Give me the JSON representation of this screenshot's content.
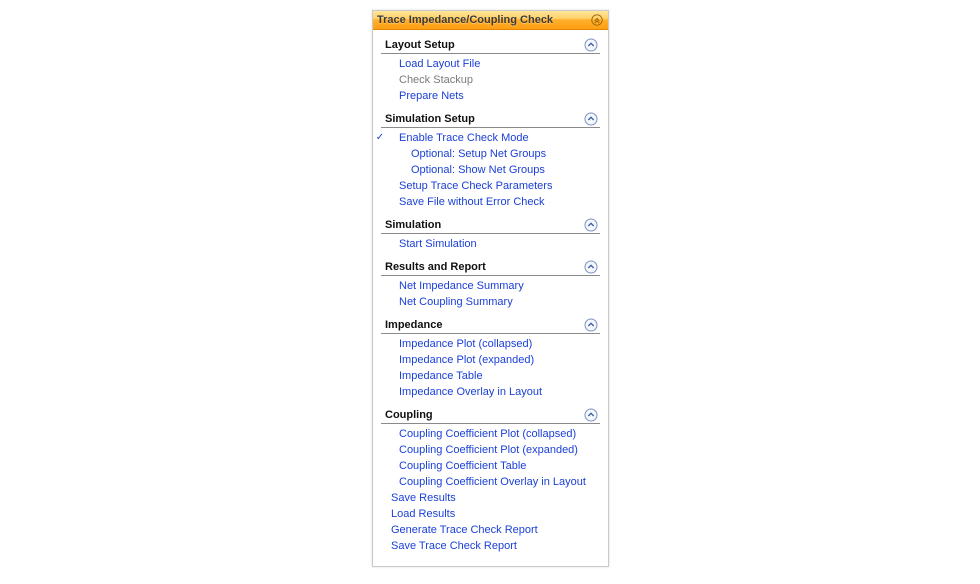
{
  "panel": {
    "title": "Trace Impedance/Coupling Check"
  },
  "sections": {
    "layout_setup": {
      "title": "Layout Setup",
      "items": {
        "load_layout_file": "Load Layout File",
        "check_stackup": "Check Stackup",
        "prepare_nets": "Prepare Nets"
      }
    },
    "simulation_setup": {
      "title": "Simulation Setup",
      "items": {
        "enable_trace_check_mode": "Enable Trace Check Mode",
        "setup_net_groups": "Optional: Setup Net Groups",
        "show_net_groups": "Optional: Show Net Groups",
        "setup_trace_check_params": "Setup Trace Check Parameters",
        "save_file_without_error_check": "Save File without Error Check"
      }
    },
    "simulation": {
      "title": "Simulation",
      "items": {
        "start_simulation": "Start Simulation"
      }
    },
    "results_report": {
      "title": "Results and Report",
      "items": {
        "net_impedance_summary": "Net Impedance Summary",
        "net_coupling_summary": "Net Coupling Summary"
      }
    },
    "impedance": {
      "title": "Impedance",
      "items": {
        "impedance_plot_collapsed": "Impedance Plot (collapsed)",
        "impedance_plot_expanded": "Impedance Plot (expanded)",
        "impedance_table": "Impedance Table",
        "impedance_overlay_layout": "Impedance Overlay in Layout"
      }
    },
    "coupling": {
      "title": "Coupling",
      "items": {
        "cc_plot_collapsed": "Coupling Coefficient Plot (collapsed)",
        "cc_plot_expanded": "Coupling Coefficient Plot (expanded)",
        "cc_table": "Coupling Coefficient Table",
        "cc_overlay_layout": "Coupling Coefficient Overlay in Layout",
        "save_results": "Save Results",
        "load_results": "Load Results",
        "generate_trace_check_report": "Generate Trace Check Report",
        "save_trace_check_report": "Save Trace Check Report"
      }
    }
  }
}
